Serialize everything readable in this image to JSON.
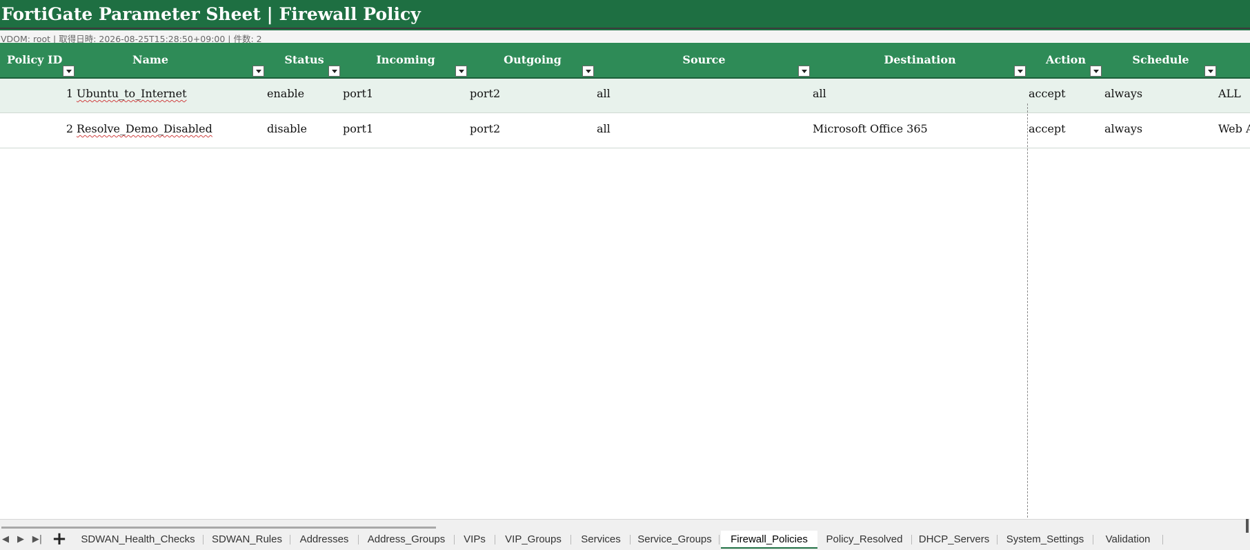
{
  "sheet": {
    "title": "FortiGate Parameter Sheet | Firewall Policy",
    "subtitle": "VDOM: root | 取得日時: 2026-08-25T15:28:50+09:00 | 件数: 2"
  },
  "table": {
    "columns": [
      "Policy ID",
      "Name",
      "Status",
      "Incoming",
      "Outgoing",
      "Source",
      "Destination",
      "Action",
      "Schedule"
    ],
    "rows": [
      {
        "policy_id": "1",
        "name": "Ubuntu_to_Internet",
        "status": "enable",
        "incoming": "port1",
        "outgoing": "port2",
        "source": "all",
        "destination": "all",
        "action": "accept",
        "schedule": "always",
        "service": "ALL"
      },
      {
        "policy_id": "2",
        "name": "Resolve_Demo_Disabled",
        "status": "disable",
        "incoming": "port1",
        "outgoing": "port2",
        "source": "all",
        "destination": "Microsoft Office 365",
        "action": "accept",
        "schedule": "always",
        "service": "Web A"
      }
    ]
  },
  "tabs": {
    "items": [
      "SDWAN_Health_Checks",
      "SDWAN_Rules",
      "Addresses",
      "Address_Groups",
      "VIPs",
      "VIP_Groups",
      "Services",
      "Service_Groups",
      "Firewall_Policies",
      "Policy_Resolved",
      "DHCP_Servers",
      "System_Settings",
      "Validation"
    ],
    "active": "Firewall_Policies",
    "add_label": "+"
  },
  "colors": {
    "title_bg": "#1e6f42",
    "header_bg": "#2e8b57",
    "alt_row_bg": "#e8f2ec"
  },
  "icons": [
    "filter-dropdown-icon",
    "first-sheet-icon",
    "prev-sheet-icon",
    "next-sheet-icon",
    "add-sheet-icon"
  ]
}
